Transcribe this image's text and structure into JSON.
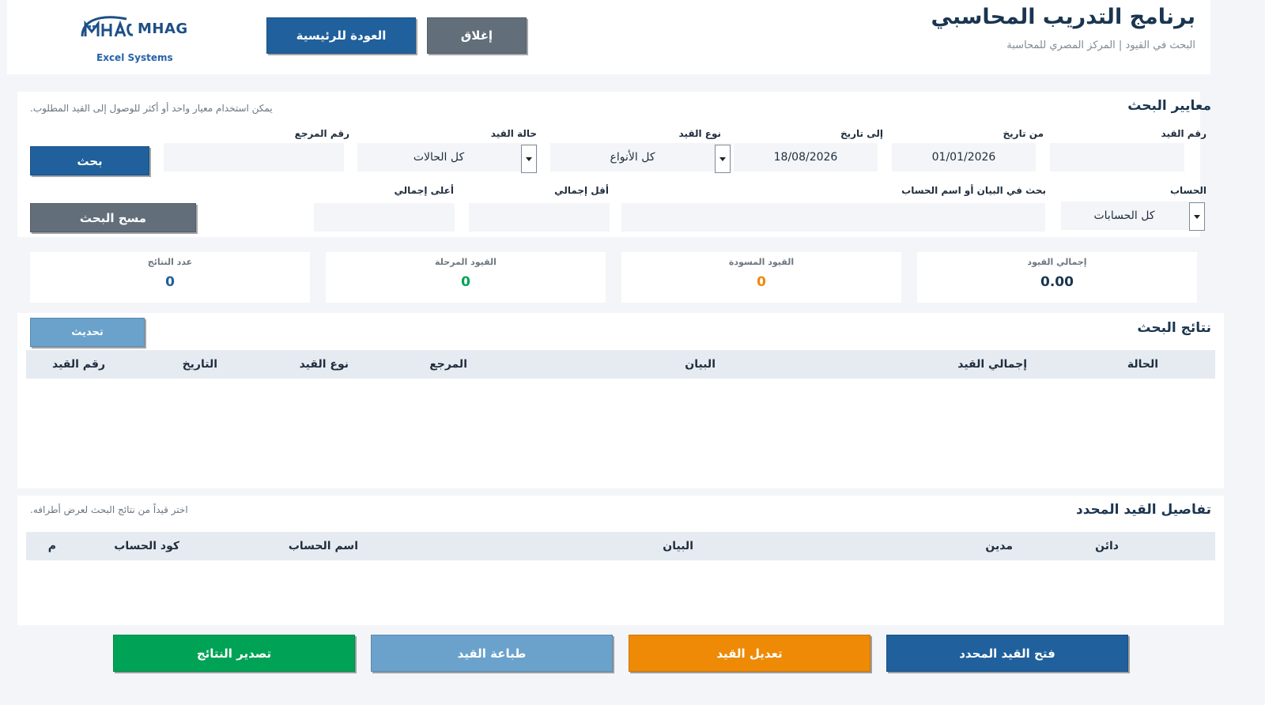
{
  "header": {
    "title": "برنامج التدريب المحاسبي",
    "subtitle": "البحث في القيود | المركز المصري للمحاسبة",
    "close_label": "إغلاق",
    "home_label": "العودة للرئيسية",
    "logo_text": "MHAG",
    "logo_sub": "Excel Systems"
  },
  "criteria": {
    "title": "معايير البحث",
    "hint": "يمكن استخدام معيار واحد أو أكثر للوصول إلى القيد المطلوب.",
    "entry_no_label": "رقم القيد",
    "entry_no_value": "",
    "from_date_label": "من تاريخ",
    "from_date_value": "01/01/2026",
    "to_date_label": "إلى تاريخ",
    "to_date_value": "18/08/2026",
    "type_label": "نوع القيد",
    "type_value": "كل الأنواع",
    "status_label": "حالة القيد",
    "status_value": "كل الحالات",
    "ref_label": "رقم المرجع",
    "ref_value": "",
    "search_label": "بحث",
    "account_label": "الحساب",
    "account_value": "كل الحسابات",
    "text_search_label": "بحث في البيان أو اسم الحساب",
    "text_search_value": "",
    "min_total_label": "أقل إجمالي",
    "min_total_value": "",
    "max_total_label": "أعلى إجمالي",
    "max_total_value": "",
    "clear_label": "مسح البحث"
  },
  "stats": {
    "total_label": "إجمالي القيود",
    "total_value": "0.00",
    "draft_label": "القيود المسودة",
    "draft_value": "0",
    "posted_label": "القيود المرحلة",
    "posted_value": "0",
    "count_label": "عدد النتائج",
    "count_value": "0",
    "colors": {
      "total": "#1b3550",
      "draft": "#ee8a06",
      "posted": "#00a355",
      "count": "#20609c"
    }
  },
  "results": {
    "title": "نتائج البحث",
    "refresh_label": "تحديث",
    "columns": [
      "الحالة",
      "إجمالي القيد",
      "البيان",
      "المرجع",
      "نوع القيد",
      "التاريخ",
      "رقم القيد"
    ],
    "rows": []
  },
  "details": {
    "title": "تفاصيل القيد المحدد",
    "hint": "اختر قيداً من نتائج البحث لعرض أطرافه.",
    "columns": [
      "دائن",
      "مدين",
      "البيان",
      "اسم الحساب",
      "كود الحساب",
      "م"
    ],
    "rows": []
  },
  "actions": {
    "open_label": "فتح القيد المحدد",
    "edit_label": "تعديل القيد",
    "print_label": "طباعة القيد",
    "export_label": "تصدير النتائج"
  }
}
